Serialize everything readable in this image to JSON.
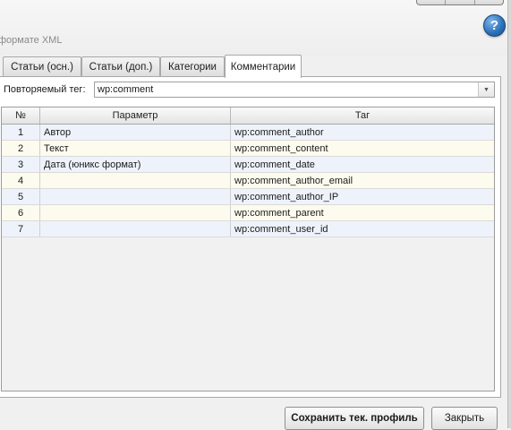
{
  "window": {
    "subtitle": "формате XML",
    "help_icon": "question-icon"
  },
  "tabs": [
    {
      "label": "Статьи (осн.)",
      "active": false
    },
    {
      "label": "Статьи (доп.)",
      "active": false
    },
    {
      "label": "Категории",
      "active": false
    },
    {
      "label": "Комментарии",
      "active": true
    }
  ],
  "repeat_tag": {
    "label": "Повторяемый тег:",
    "value": "wp:comment"
  },
  "grid": {
    "columns": [
      "№",
      "Параметр",
      "Таг"
    ],
    "rows": [
      {
        "num": "1",
        "param": "Автор",
        "tag": "wp:comment_author"
      },
      {
        "num": "2",
        "param": "Текст",
        "tag": "wp:comment_content"
      },
      {
        "num": "3",
        "param": "Дата (юникс формат)",
        "tag": "wp:comment_date"
      },
      {
        "num": "4",
        "param": "",
        "tag": "wp:comment_author_email"
      },
      {
        "num": "5",
        "param": "",
        "tag": "wp:comment_author_IP"
      },
      {
        "num": "6",
        "param": "",
        "tag": "wp:comment_parent"
      },
      {
        "num": "7",
        "param": "",
        "tag": "wp:comment_user_id"
      }
    ]
  },
  "buttons": {
    "save_profile": "Сохранить тек. профиль",
    "close": "Закрыть"
  },
  "colors": {
    "row_odd": "#eef3fb",
    "row_even": "#fcfbee",
    "help_blue": "#2a6fb8"
  }
}
